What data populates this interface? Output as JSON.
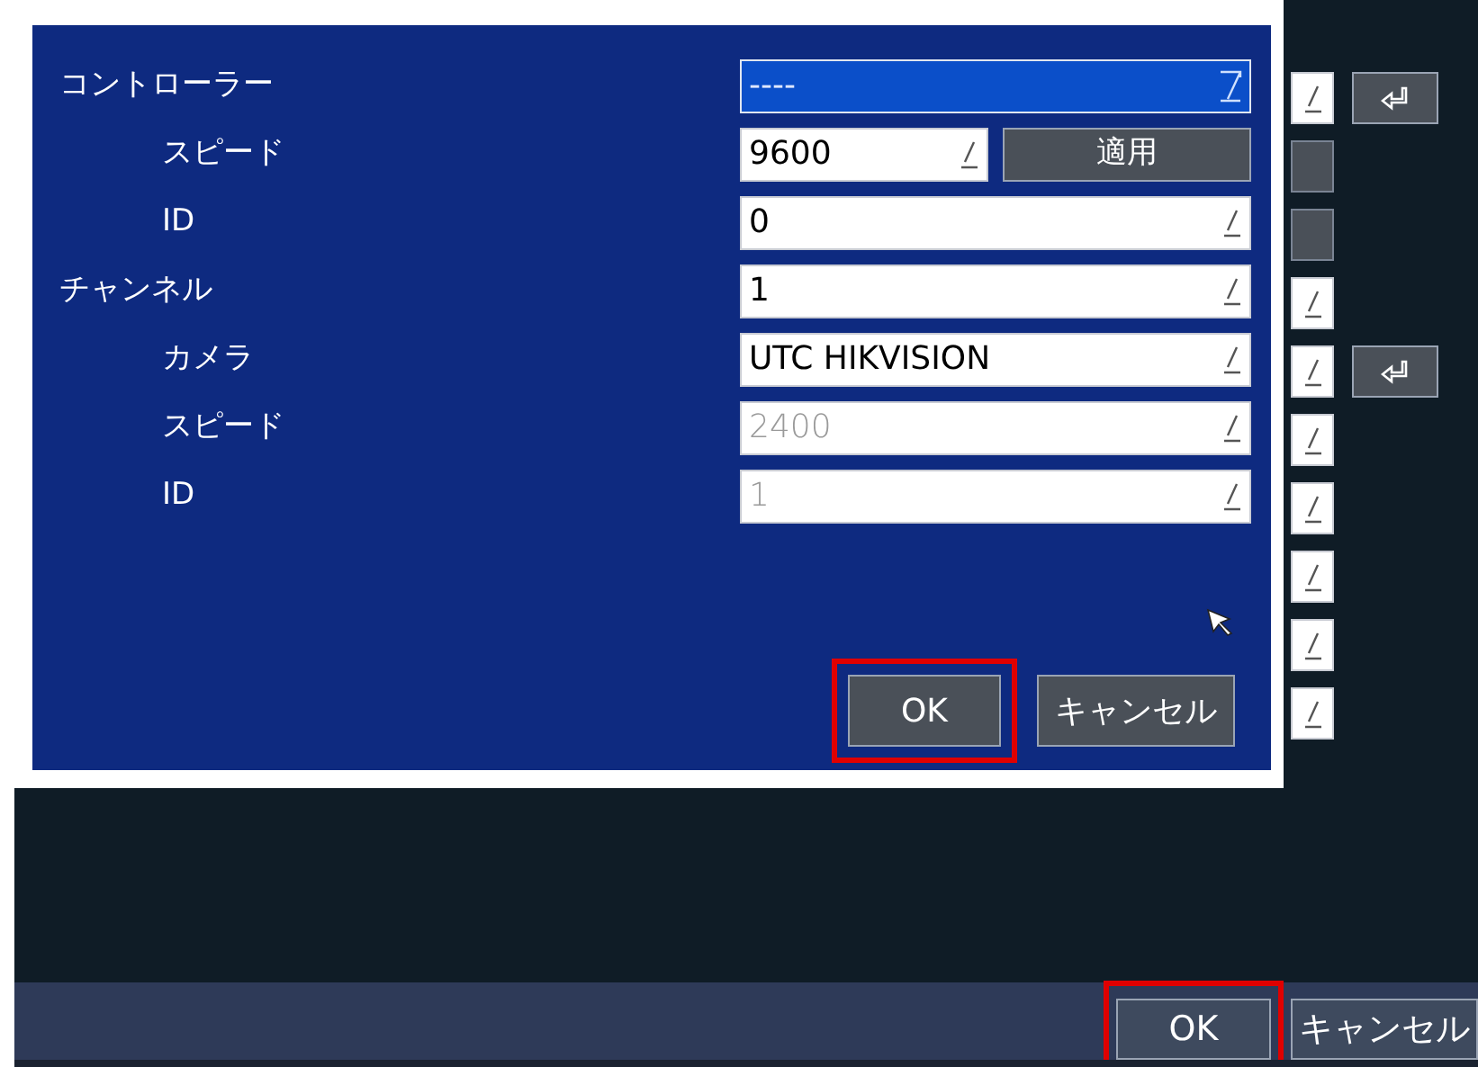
{
  "dialog": {
    "rows": [
      {
        "label": "コントローラー",
        "field": {
          "kind": "dropdown",
          "value": "----",
          "focused": true,
          "disabled": false
        },
        "children": [
          {
            "label": "スピード",
            "field": {
              "kind": "text",
              "value": "9600",
              "focused": false,
              "disabled": false
            },
            "button": "適用"
          },
          {
            "label": "ID",
            "field": {
              "kind": "text",
              "value": "0",
              "focused": false,
              "disabled": false
            }
          }
        ]
      },
      {
        "label": "チャンネル",
        "field": {
          "kind": "text",
          "value": "1",
          "focused": false,
          "disabled": false
        },
        "children": [
          {
            "label": "カメラ",
            "field": {
              "kind": "text",
              "value": "UTC HIKVISION",
              "focused": false,
              "disabled": false
            }
          },
          {
            "label": "スピード",
            "field": {
              "kind": "text",
              "value": "2400",
              "focused": false,
              "disabled": true
            }
          },
          {
            "label": "ID",
            "field": {
              "kind": "text",
              "value": "1",
              "focused": false,
              "disabled": true
            }
          }
        ]
      }
    ],
    "buttons": [
      {
        "label": "OK",
        "highlighted": true
      },
      {
        "label": "キャンセル",
        "highlighted": false
      }
    ]
  },
  "side_rows": [
    {
      "kind": "field",
      "enter": true
    },
    {
      "kind": "blank",
      "enter": false
    },
    {
      "kind": "blank",
      "enter": false
    },
    {
      "kind": "field",
      "enter": false
    },
    {
      "kind": "field",
      "enter": true
    },
    {
      "kind": "field",
      "enter": false
    },
    {
      "kind": "field",
      "enter": false
    },
    {
      "kind": "field",
      "enter": false
    },
    {
      "kind": "field",
      "enter": false
    },
    {
      "kind": "field",
      "enter": false
    }
  ],
  "footer": {
    "buttons": [
      {
        "label": "OK",
        "highlighted": true
      },
      {
        "label": "キャンセル",
        "highlighted": false
      }
    ]
  }
}
